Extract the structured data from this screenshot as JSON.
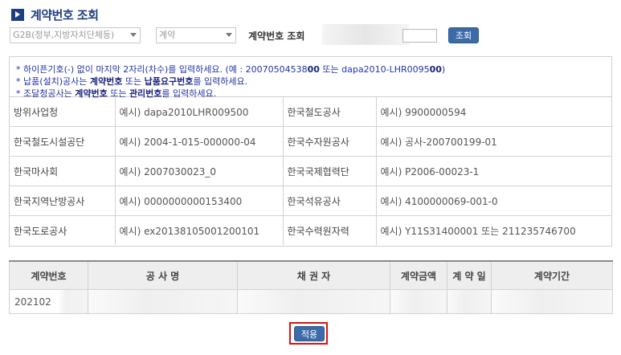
{
  "header": {
    "title": "계약번호 조회"
  },
  "filters": {
    "agency_select": "G2B(정부,지방자치단체등)",
    "type_select": "계약",
    "contract_label": "계약번호 조회",
    "contract_value": "",
    "search_label": "조회"
  },
  "info": {
    "line1": {
      "part1": "* 하이픈기호(-) 없이 마지막 2자리(차수)를 입력하세요. (예 : 20070504538",
      "bold1": "00",
      "part2": " 또는 dapa2010-LHR0095",
      "bold2": "00",
      "part3": ")"
    },
    "line2": {
      "part1": "* 납품(설치)공사는 ",
      "bold1": "계약번호",
      "part2": " 또는 ",
      "bold2": "납품요구번호",
      "part3": "를 입력하세요."
    },
    "line3": {
      "part1": "* 조달청공사는 ",
      "bold1": "계약번호",
      "part2": " 또는 ",
      "bold2": "관리번호",
      "part3": "를 입력하세요."
    }
  },
  "examples": [
    [
      {
        "org": "방위사업청",
        "example": "예시) dapa2010LHR009500"
      },
      {
        "org": "한국철도공사",
        "example": "예시) 9900000594"
      }
    ],
    [
      {
        "org": "한국철도시설공단",
        "example": "예시) 2004-1-015-000000-04"
      },
      {
        "org": "한국수자원공사",
        "example": "예시) 공사-200700199-01"
      }
    ],
    [
      {
        "org": "한국마사회",
        "example": "예시) 2007030023_0"
      },
      {
        "org": "한국국제협력단",
        "example": "예시) P2006-00023-1"
      }
    ],
    [
      {
        "org": "한국지역난방공사",
        "example": "예시) 0000000000153400"
      },
      {
        "org": "한국석유공사",
        "example": "예시) 4100000069-001-0"
      }
    ],
    [
      {
        "org": "한국도로공사",
        "example": "예시) ex20138105001200101"
      },
      {
        "org": "한국수력원자력",
        "example": "예시) Y11S31400001 또는 211235746700"
      }
    ]
  ],
  "results": {
    "columns": [
      "계약번호",
      "공 사 명",
      "채 권 자",
      "계약금액",
      "계 약 일",
      "계약기간"
    ],
    "rows": [
      {
        "contract_no": "202102",
        "name": "",
        "creditor": "",
        "amount": "",
        "date": "",
        "period": ""
      }
    ]
  },
  "apply": {
    "label": "적용"
  },
  "colors": {
    "title": "#1d3f82",
    "button": "#3d6aa8",
    "info_text": "#2233aa",
    "highlight": "#e01010"
  }
}
